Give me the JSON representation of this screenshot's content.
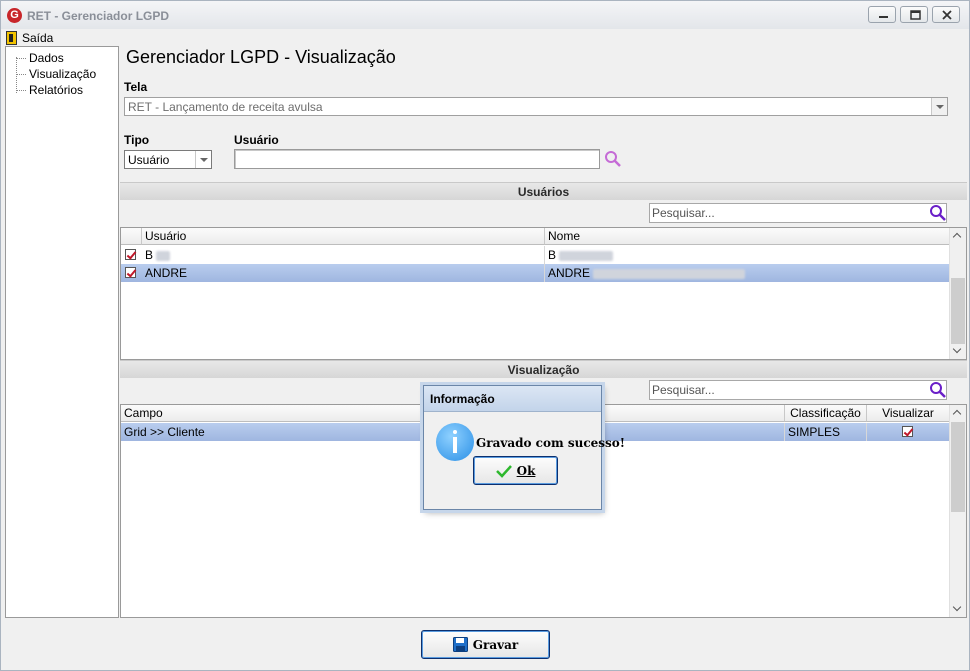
{
  "window": {
    "title": "RET - Gerenciador LGPD",
    "icon_letter": "G"
  },
  "menu": {
    "exit_label": "Saída"
  },
  "sidebar": {
    "items": [
      {
        "label": "Dados"
      },
      {
        "label": "Visualização"
      },
      {
        "label": "Relatórios"
      }
    ]
  },
  "main": {
    "title": "Gerenciador LGPD - Visualização",
    "tela_label": "Tela",
    "tela_value": "RET - Lançamento de receita avulsa",
    "tipo_label": "Tipo",
    "tipo_value": "Usuário",
    "usuario_label": "Usuário",
    "usuario_value": ""
  },
  "users_section": {
    "header": "Usuários",
    "search_placeholder": "Pesquisar...",
    "columns": [
      "Usuário",
      "Nome"
    ],
    "rows": [
      {
        "checked": true,
        "usuario": "B",
        "nome": "B",
        "selected": false
      },
      {
        "checked": true,
        "usuario": "ANDRE",
        "nome": "ANDRE",
        "selected": true
      }
    ]
  },
  "view_section": {
    "header": "Visualização",
    "search_placeholder": "Pesquisar...",
    "columns": [
      "Campo",
      "Classificação",
      "Visualizar"
    ],
    "rows": [
      {
        "campo": "Grid >> Cliente",
        "classificacao": "SIMPLES",
        "visualizar": true,
        "selected": true
      }
    ]
  },
  "dialog": {
    "title": "Informação",
    "message": "Gravado com sucesso!",
    "ok_label": "Ok"
  },
  "footer": {
    "save_label": "Gravar"
  },
  "colors": {
    "selection": "#a9bfe6",
    "brand": "#c8262a",
    "accent": "#2a8fe6"
  }
}
